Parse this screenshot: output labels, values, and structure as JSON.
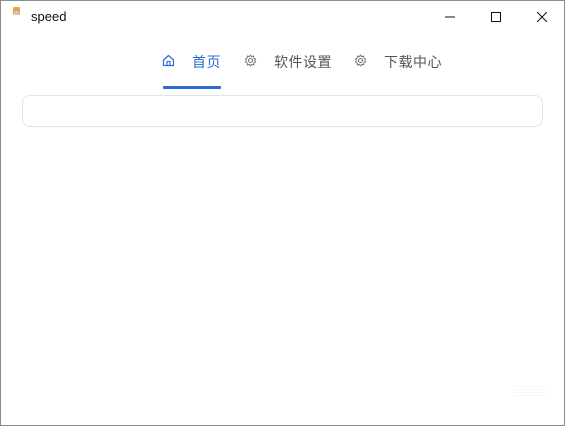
{
  "window": {
    "title": "speed",
    "controls": {
      "minimize": "minimize",
      "maximize": "maximize",
      "close": "close"
    }
  },
  "tabs": [
    {
      "label": "首页",
      "icon": "home-icon",
      "active": true
    },
    {
      "label": "软件设置",
      "icon": "gear-icon",
      "active": false
    },
    {
      "label": "下载中心",
      "icon": "gear-icon",
      "active": false
    }
  ],
  "search": {
    "value": "",
    "placeholder": ""
  },
  "colors": {
    "accent": "#2d6bd6",
    "inactive_text": "#555555",
    "border": "#e3e3e3",
    "icon_orange": "#f0a23a"
  }
}
